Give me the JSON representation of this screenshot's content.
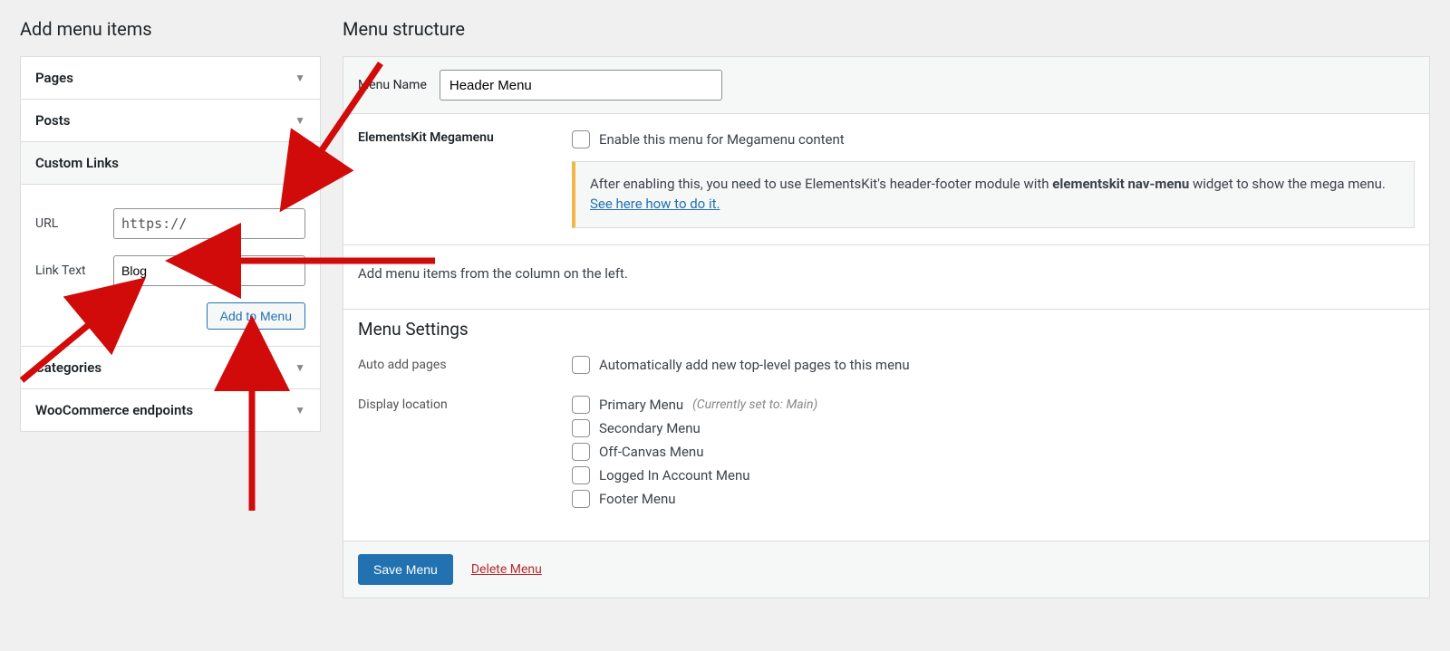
{
  "left": {
    "title": "Add menu items",
    "sections": {
      "pages": "Pages",
      "posts": "Posts",
      "custom_links": "Custom Links",
      "categories": "Categories",
      "woo": "WooCommerce endpoints"
    },
    "custom_links": {
      "url_label": "URL",
      "url_value": "https://",
      "link_text_label": "Link Text",
      "link_text_value": "Blog",
      "add_btn": "Add to Menu"
    }
  },
  "right": {
    "title": "Menu structure",
    "menu_name_label": "Menu Name",
    "menu_name_value": "Header Menu",
    "mega_label": "ElementsKit Megamenu",
    "mega_checkbox_label": "Enable this menu for Megamenu content",
    "mega_notice_text_a": "After enabling this, you need to use ElementsKit's header-footer module with ",
    "mega_notice_bold": "elementskit nav-menu",
    "mega_notice_text_b": " widget to show the mega menu. ",
    "mega_notice_link": "See here how to do it.",
    "hint": "Add menu items from the column on the left.",
    "settings_head": "Menu Settings",
    "auto_add_label": "Auto add pages",
    "auto_add_chk": "Automatically add new top-level pages to this menu",
    "display_loc_label": "Display location",
    "locations": {
      "primary": "Primary Menu",
      "primary_note": "(Currently set to: Main)",
      "secondary": "Secondary Menu",
      "offcanvas": "Off-Canvas Menu",
      "logged": "Logged In Account Menu",
      "footer": "Footer Menu"
    },
    "save_btn": "Save Menu",
    "delete_link": "Delete Menu"
  }
}
